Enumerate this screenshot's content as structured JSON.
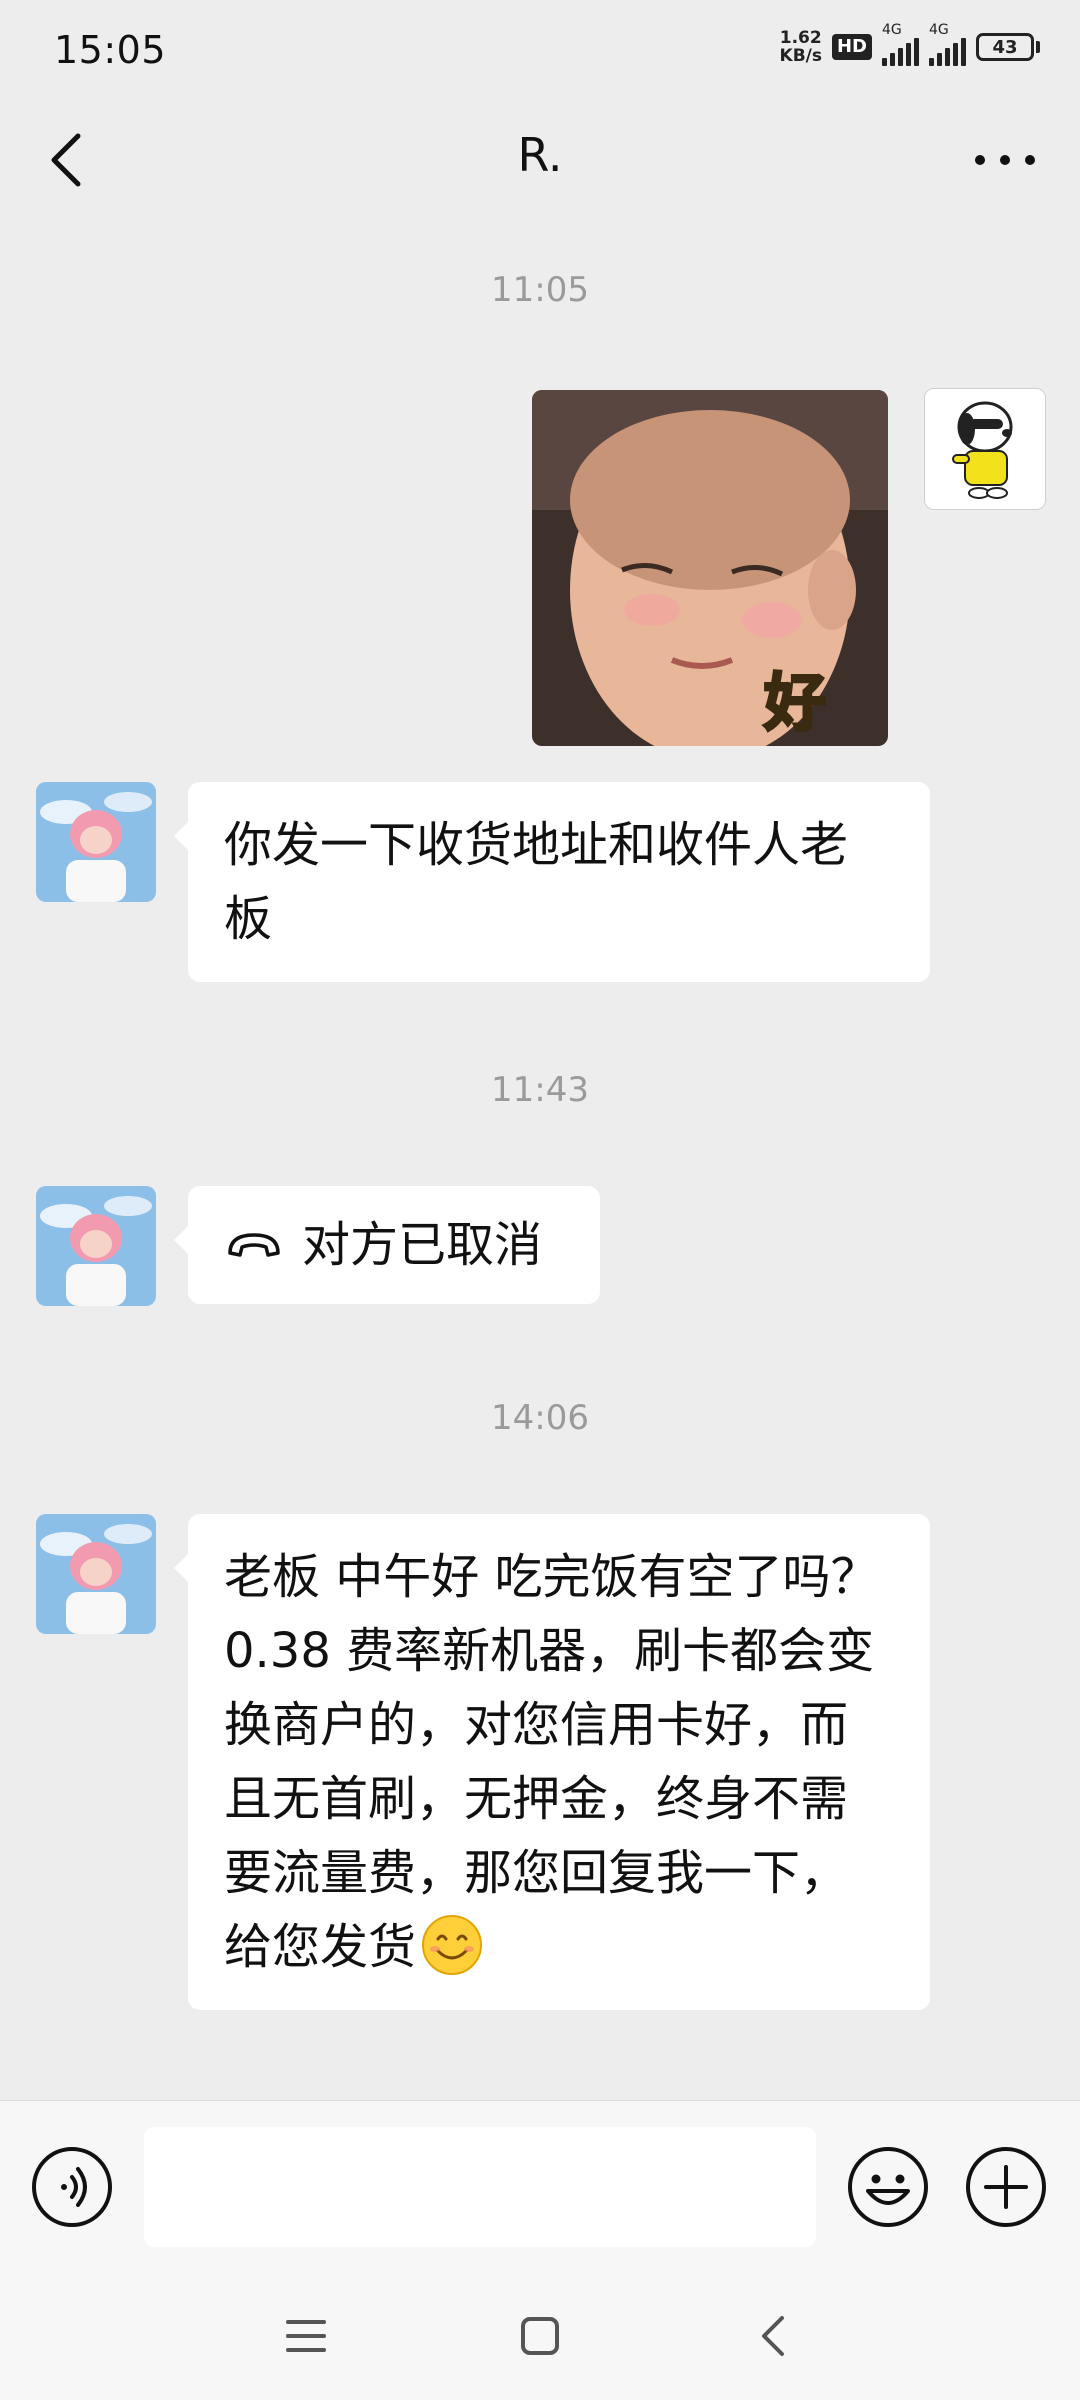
{
  "status_bar": {
    "time": "15:05",
    "net_speed_value": "1.62",
    "net_speed_unit": "KB/s",
    "hd_label": "HD",
    "signal1_label": "4G",
    "signal2_label": "4G",
    "battery_level": "43"
  },
  "header": {
    "title": "R."
  },
  "messages": {
    "ts1": "11:05",
    "bubble1_text": "你发一下收货地址和收件人老板",
    "ts2": "11:43",
    "call_text": "对方已取消",
    "ts3": "14:06",
    "bubble3_text": "老板 中午好 吃完饭有空了吗？0.38 费率新机器，刷卡都会变换商户的，对您信用卡好，而且无首刷，无押金，终身不需要流量费，那您回复我一下，给您发货",
    "sticker_caption": "好"
  },
  "input_bar": {
    "placeholder": ""
  },
  "icons": {
    "back": "back-arrow-icon",
    "more": "more-icon",
    "voice": "voice-icon",
    "emoji": "emoji-icon",
    "plus": "plus-icon",
    "phone": "phone-icon",
    "smile_emoji": "smile-emoji-icon"
  },
  "colors": {
    "background": "#ededed",
    "bubble_other": "#ffffff",
    "timestamp": "#9a9a9a"
  }
}
